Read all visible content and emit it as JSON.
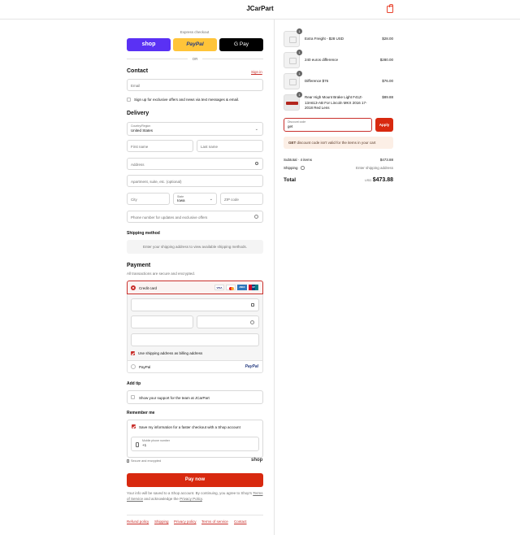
{
  "header": {
    "brand": "JCarPart",
    "cart_icon": "shopping-bag-icon"
  },
  "express": {
    "title": "Express checkout",
    "shop_label": "shop",
    "paypal_label": "PayPal",
    "gpay_label": "G Pay",
    "or_label": "OR"
  },
  "contact": {
    "title": "Contact",
    "signin_label": "Sign in",
    "email_placeholder": "Email",
    "news_label": "Sign up for exclusive offers and news via text messages & email."
  },
  "delivery": {
    "title": "Delivery",
    "country_label": "Country/Region",
    "country_value": "United States",
    "first_name_placeholder": "First name",
    "last_name_placeholder": "Last name",
    "address_placeholder": "Address",
    "apartment_placeholder": "Apartment, suite, etc. (optional)",
    "city_placeholder": "City",
    "state_label": "State",
    "state_value": "Iowa",
    "zip_placeholder": "ZIP code",
    "phone_placeholder": "Phone number for updates and exclusive offers"
  },
  "shipping_method": {
    "title": "Shipping method",
    "notice": "Enter your shipping address to view available shipping methods."
  },
  "payment": {
    "title": "Payment",
    "subtitle": "All transactions are secure and encrypted.",
    "credit_card_label": "Credit card",
    "card_brands": [
      "VISA",
      "MC",
      "AMEX",
      "UP"
    ],
    "billing_label": "Use shipping address as billing address",
    "paypal_label": "PayPal",
    "paypal_logo": "PayPal"
  },
  "tip": {
    "title": "Add tip",
    "label": "Show your support for the team at JCarPart"
  },
  "remember": {
    "title": "Remember me",
    "save_label": "Save my information for a faster checkout with a Shop account",
    "mobile_label": "Mobile phone number",
    "mobile_value": "+1",
    "secure_label": "Secure and encrypted",
    "shop_logo": "shop"
  },
  "pay_button": "Pay now",
  "legal": {
    "text_1": "Your info will be saved to a Shop account. By continuing, you agree to Shop's",
    "terms_link": "Terms of Service",
    "text_2": "and acknowledge the",
    "privacy_link": "Privacy Policy",
    "text_3": "."
  },
  "footer_links": [
    "Refund policy",
    "Shipping",
    "Privacy policy",
    "Terms of service",
    "Contact"
  ],
  "order": {
    "items": [
      {
        "qty": "1",
        "name": "Extra Freight - $28 USD",
        "price": "$28.00"
      },
      {
        "qty": "1",
        "name": "240 euros difference",
        "price": "$280.00"
      },
      {
        "qty": "1",
        "name": "Difference $76",
        "price": "$76.00"
      },
      {
        "qty": "1",
        "name": "Rear High Mount Brake Light F41Z-13A613-AB For Lincoln MKX 2016 17-2018 Red Lens",
        "price": "$89.88"
      }
    ],
    "discount_label": "Discount code",
    "discount_value": "get",
    "apply_label": "Apply",
    "error_code": "GET",
    "error_text": "discount code isn't valid for the items in your cart",
    "subtotal_label": "Subtotal · 4 items",
    "subtotal_value": "$473.88",
    "shipping_label": "Shipping",
    "shipping_value": "Enter shipping address",
    "total_label": "Total",
    "currency": "USD",
    "total_value": "$473.88"
  },
  "colors": {
    "accent": "#c9302c",
    "pay_button": "#d8290f",
    "shop_purple": "#5a31f4",
    "paypal_yellow": "#ffc439"
  }
}
